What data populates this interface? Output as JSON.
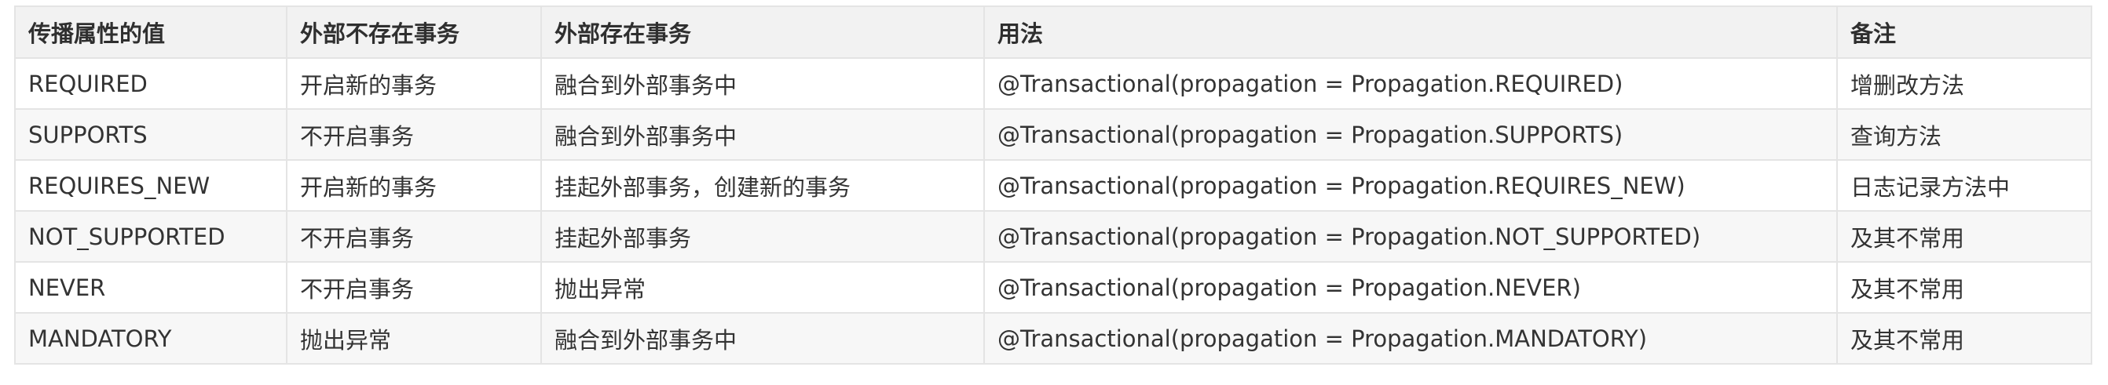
{
  "table": {
    "headers": [
      "传播属性的值",
      "外部不存在事务",
      "外部存在事务",
      "用法",
      "备注"
    ],
    "rows": [
      [
        "REQUIRED",
        "开启新的事务",
        "融合到外部事务中",
        "@Transactional(propagation = Propagation.REQUIRED)",
        "增删改方法"
      ],
      [
        "SUPPORTS",
        "不开启事务",
        "融合到外部事务中",
        "@Transactional(propagation = Propagation.SUPPORTS)",
        "查询方法"
      ],
      [
        "REQUIRES_NEW",
        "开启新的事务",
        "挂起外部事务，创建新的事务",
        "@Transactional(propagation = Propagation.REQUIRES_NEW)",
        "日志记录方法中"
      ],
      [
        "NOT_SUPPORTED",
        "不开启事务",
        "挂起外部事务",
        "@Transactional(propagation = Propagation.NOT_SUPPORTED)",
        "及其不常用"
      ],
      [
        "NEVER",
        "不开启事务",
        "抛出异常",
        "@Transactional(propagation = Propagation.NEVER)",
        "及其不常用"
      ],
      [
        "MANDATORY",
        "抛出异常",
        "融合到外部事务中",
        "@Transactional(propagation = Propagation.MANDATORY)",
        "及其不常用"
      ]
    ]
  }
}
